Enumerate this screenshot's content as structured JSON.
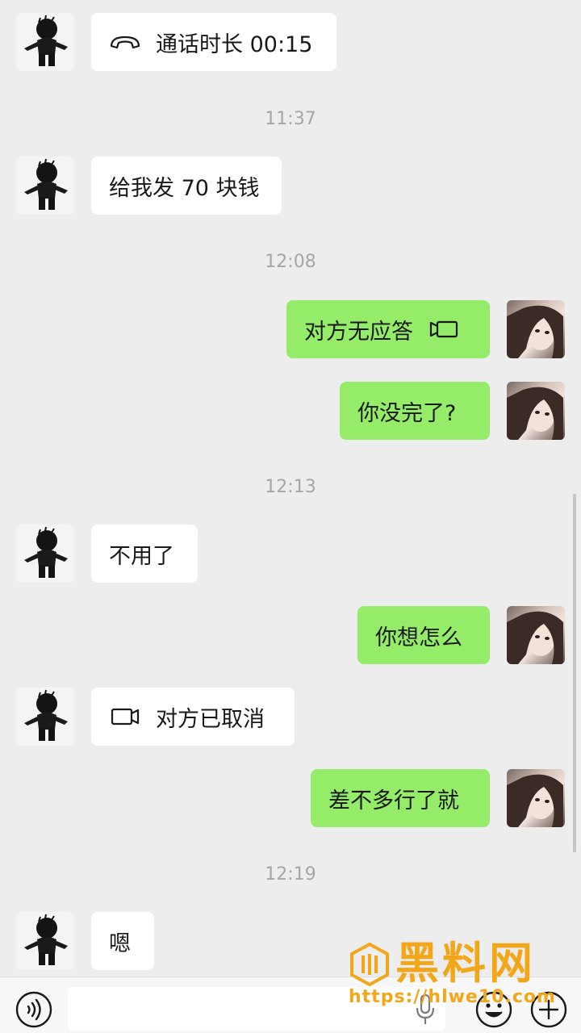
{
  "messages": [
    {
      "id": "m1",
      "side": "in",
      "kind": "voice_call",
      "text": "通话时长 00:15",
      "icon": "phone-hangup-icon"
    },
    {
      "id": "t1",
      "kind": "time",
      "text": "11:37"
    },
    {
      "id": "m2",
      "side": "in",
      "kind": "text",
      "text": "给我发 70 块钱"
    },
    {
      "id": "t2",
      "kind": "time",
      "text": "12:08"
    },
    {
      "id": "m3",
      "side": "out",
      "kind": "video_call",
      "text": "对方无应答",
      "icon": "video-call-icon"
    },
    {
      "id": "m4",
      "side": "out",
      "kind": "text",
      "text": "你没完了?"
    },
    {
      "id": "t3",
      "kind": "time",
      "text": "12:13"
    },
    {
      "id": "m5",
      "side": "in",
      "kind": "text",
      "text": "不用了"
    },
    {
      "id": "m6",
      "side": "out",
      "kind": "text",
      "text": "你想怎么"
    },
    {
      "id": "m7",
      "side": "in",
      "kind": "video_call",
      "text": "对方已取消",
      "icon": "video-call-icon"
    },
    {
      "id": "m8",
      "side": "out",
      "kind": "text",
      "text": "差不多行了就"
    },
    {
      "id": "t4",
      "kind": "time",
      "text": "12:19"
    },
    {
      "id": "m9",
      "side": "in",
      "kind": "text",
      "text": "嗯"
    }
  ],
  "input_bar": {
    "voice_icon": "voice-mode-icon",
    "emoji_icon": "emoji-icon",
    "plus_icon": "plus-icon",
    "placeholder": ""
  },
  "watermark": {
    "title": "黑料网",
    "url": "https://hlwe10.com"
  },
  "colors": {
    "background": "#ededed",
    "bubble_in": "#ffffff",
    "bubble_out": "#95ec69",
    "timestamp": "#a6a6a6",
    "watermark": "#f2a71a"
  }
}
